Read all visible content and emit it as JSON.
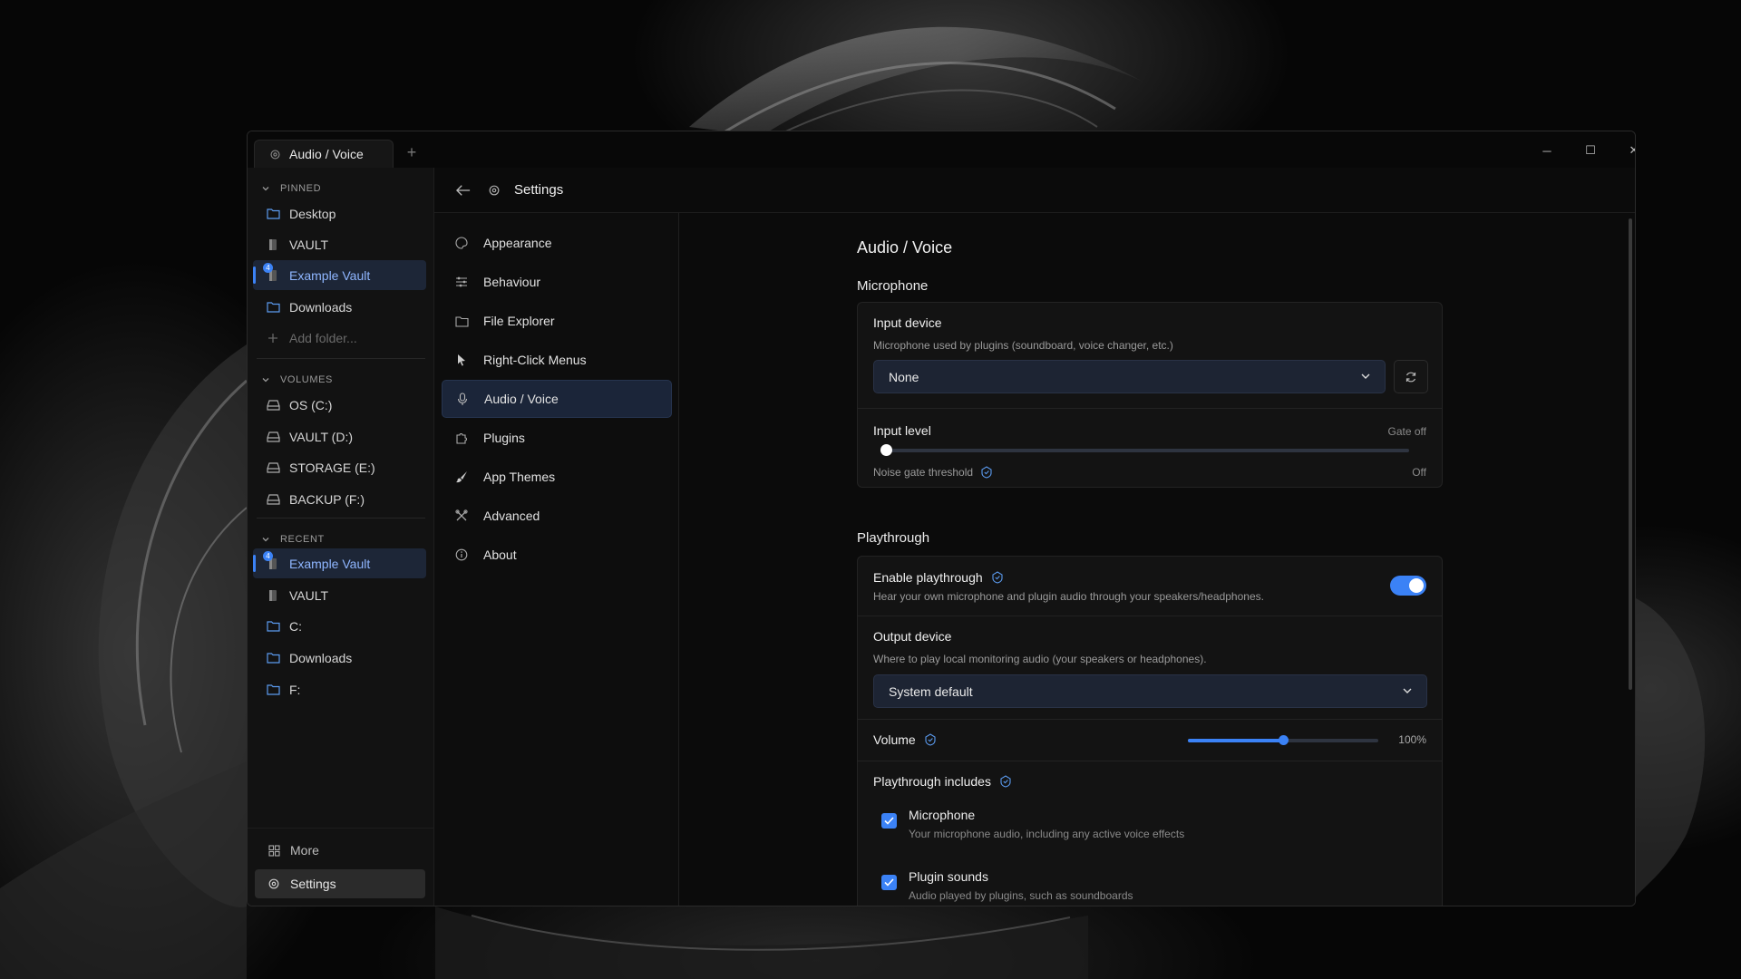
{
  "window": {
    "tab_title": "Audio / Voice",
    "tab_add": "+",
    "controls": {
      "minimize": "─",
      "maximize": "☐",
      "close": "✕"
    }
  },
  "sidebar": {
    "pinned_header": "PINNED",
    "pinned": [
      {
        "label": "Desktop",
        "icon": "folder-icon"
      },
      {
        "label": "VAULT",
        "icon": "vault-icon"
      },
      {
        "label": "Example Vault",
        "icon": "vault-icon",
        "active": true,
        "badge": "4"
      },
      {
        "label": "Downloads",
        "icon": "folder-icon"
      },
      {
        "label": "Add folder...",
        "icon": "plus-icon"
      }
    ],
    "volumes_header": "VOLUMES",
    "volumes": [
      {
        "label": "OS (C:)"
      },
      {
        "label": "VAULT (D:)"
      },
      {
        "label": "STORAGE (E:)"
      },
      {
        "label": "BACKUP (F:)"
      }
    ],
    "recent_header": "RECENT",
    "recent": [
      {
        "label": "Example Vault",
        "icon": "vault-icon",
        "active": true,
        "badge": "4"
      },
      {
        "label": "VAULT",
        "icon": "vault-icon"
      },
      {
        "label": "C:",
        "icon": "folder-icon"
      },
      {
        "label": "Downloads",
        "icon": "folder-icon"
      },
      {
        "label": "F:",
        "icon": "folder-icon"
      }
    ],
    "more_label": "More",
    "settings_label": "Settings"
  },
  "header": {
    "title": "Settings"
  },
  "settings_menu": [
    {
      "label": "Appearance",
      "icon": "palette-icon"
    },
    {
      "label": "Behaviour",
      "icon": "sliders-icon"
    },
    {
      "label": "File Explorer",
      "icon": "folder-icon"
    },
    {
      "label": "Right-Click Menus",
      "icon": "cursor-icon"
    },
    {
      "label": "Audio / Voice",
      "icon": "microphone-icon",
      "active": true
    },
    {
      "label": "Plugins",
      "icon": "puzzle-icon"
    },
    {
      "label": "App Themes",
      "icon": "brush-icon"
    },
    {
      "label": "Advanced",
      "icon": "tools-icon"
    },
    {
      "label": "About",
      "icon": "info-icon"
    }
  ],
  "main": {
    "page_title": "Audio / Voice",
    "microphone": {
      "section_title": "Microphone",
      "input_device_label": "Input device",
      "input_device_desc": "Microphone used by plugins (soundboard, voice changer, etc.)",
      "input_device_value": "None",
      "input_level_label": "Input level",
      "input_level_status": "Gate off",
      "input_level_fraction": 0,
      "noise_gate_label": "Noise gate threshold",
      "noise_gate_value": "Off"
    },
    "playthrough": {
      "section_title": "Playthrough",
      "enable_label": "Enable playthrough",
      "enable_desc": "Hear your own microphone and plugin audio through your speakers/headphones.",
      "enabled": true,
      "output_device_label": "Output device",
      "output_device_desc": "Where to play local monitoring audio (your speakers or headphones).",
      "output_device_value": "System default",
      "volume_label": "Volume",
      "volume_value": "100%",
      "volume_fraction": 0.5,
      "includes_label": "Playthrough includes",
      "includes": [
        {
          "title": "Microphone",
          "desc": "Your microphone audio, including any active voice effects",
          "checked": true
        },
        {
          "title": "Plugin sounds",
          "desc": "Audio played by plugins, such as soundboards",
          "checked": true
        }
      ]
    }
  },
  "colors": {
    "accent": "#3b82f6",
    "active_bg": "#1d2637"
  }
}
